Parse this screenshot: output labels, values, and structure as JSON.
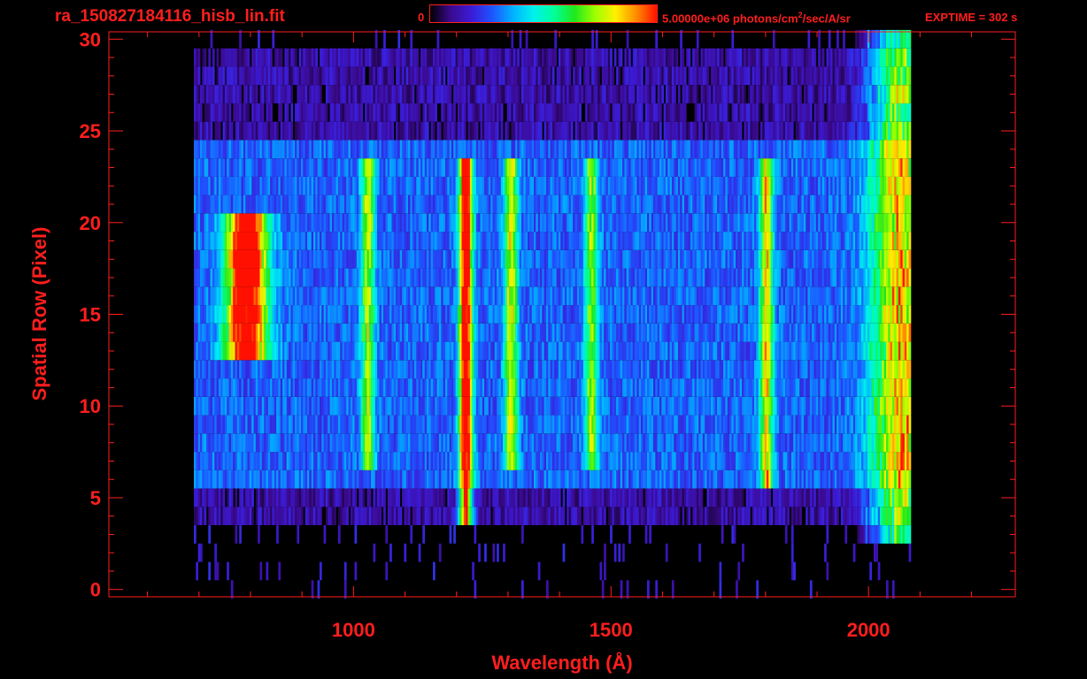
{
  "header": {
    "file_title": "ra_150827184116_hisb_lin.fit",
    "colorbar_min": "0",
    "colorbar_max_prefix": "5.00000e+06 photons/cm",
    "colorbar_max_exp": "2",
    "colorbar_max_suffix": "/sec/A/sr",
    "exptime": "EXPTIME = 302 s"
  },
  "colors": {
    "axis": "#ff1e1e",
    "background": "#000000",
    "colormap": [
      "#000000",
      "#3b0a8f",
      "#3b1bd6",
      "#1e54ff",
      "#00b0ff",
      "#00f0ee",
      "#00ff9c",
      "#1ee81e",
      "#9cff00",
      "#fff000",
      "#ff8c00",
      "#ff1000"
    ]
  },
  "chart_data": {
    "type": "heatmap",
    "title": "",
    "xlabel": "Wavelength (Å)",
    "ylabel": "Spatial Row (Pixel)",
    "xlim": [
      525,
      2285
    ],
    "ylim": [
      -0.4,
      30.4
    ],
    "x_ticks": [
      1000,
      1500,
      2000
    ],
    "y_ticks": [
      0,
      5,
      10,
      15,
      20,
      25,
      30
    ],
    "colorbar_range": [
      0,
      5000000
    ],
    "colorbar_unit": "photons/cm^2/sec/A/sr",
    "data_extent": {
      "x": [
        690,
        2080
      ],
      "rows": [
        0,
        30
      ]
    },
    "illuminated_rows": [
      6,
      24
    ],
    "emission_features": [
      {
        "label": "Ly-alpha",
        "x": 1216,
        "rows": [
          4,
          23
        ],
        "level": 0.95
      },
      {
        "label": "O I",
        "x": 1304,
        "rows": [
          7,
          23
        ],
        "level": 0.55
      },
      {
        "label": "line 1026",
        "x": 1026,
        "rows": [
          7,
          23
        ],
        "level": 0.5
      },
      {
        "label": "band 1460",
        "x": 1460,
        "rows": [
          7,
          23
        ],
        "level": 0.45
      },
      {
        "label": "band 1800",
        "x": 1800,
        "rows": [
          6,
          23
        ],
        "level": 0.6
      },
      {
        "label": "blob 770-830",
        "x": 790,
        "rows": [
          13,
          20
        ],
        "level": 0.98
      }
    ],
    "red_edge": {
      "x": 2060,
      "level": 0.7
    }
  }
}
